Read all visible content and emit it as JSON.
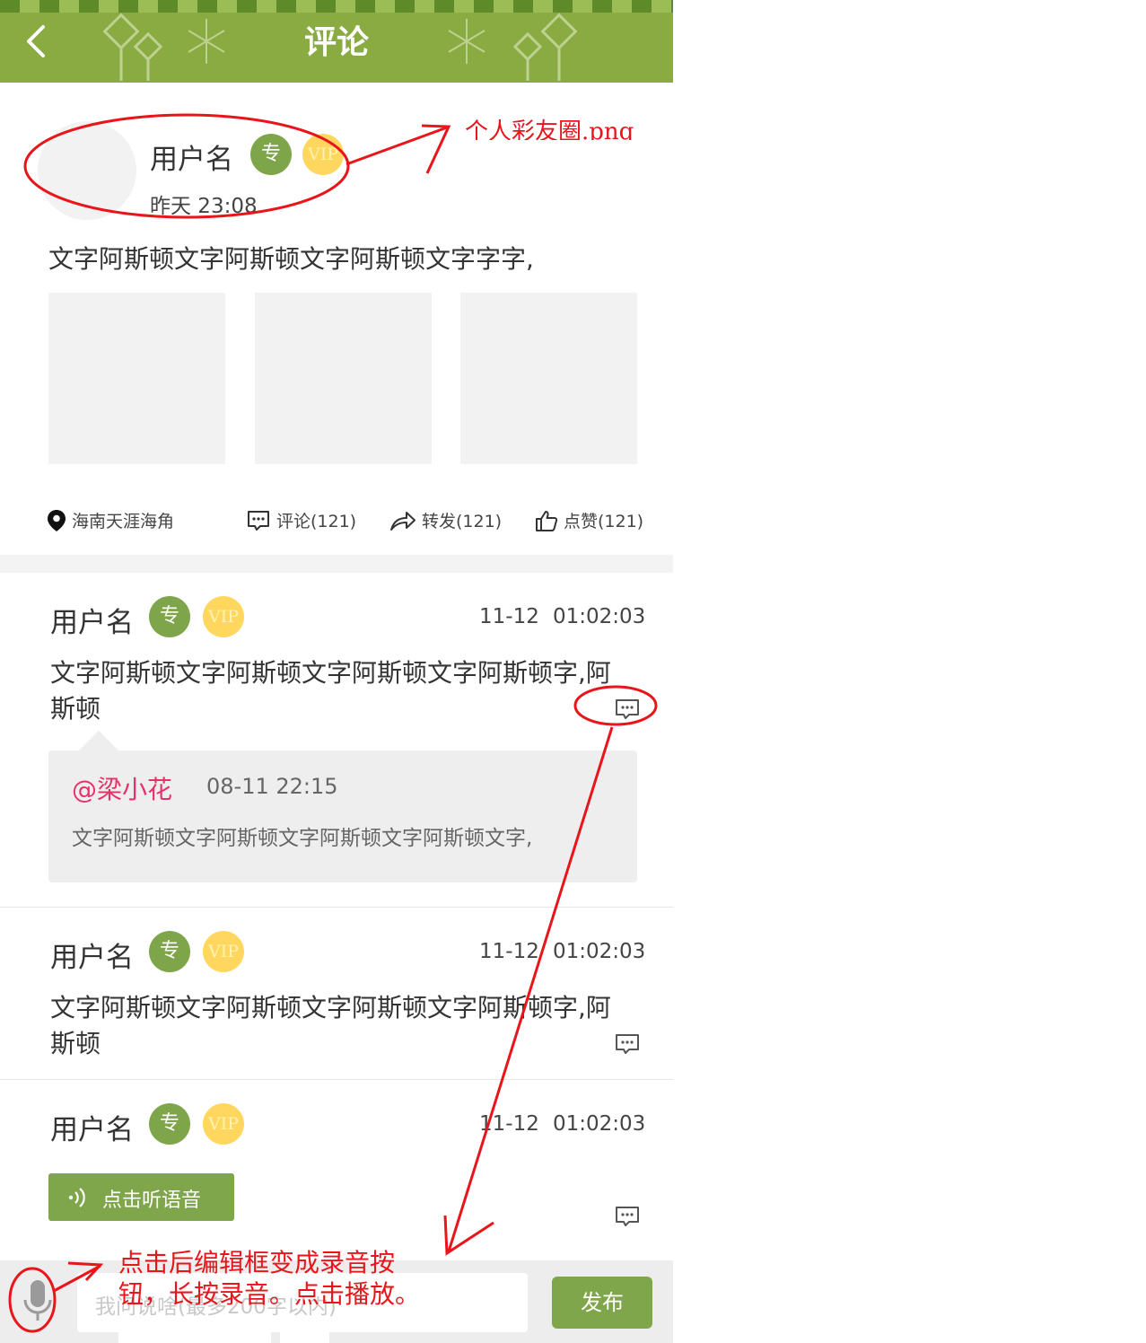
{
  "header": {
    "title": "评论"
  },
  "post": {
    "username": "用户名",
    "badge_zhuan": "专",
    "badge_vip": "VIP",
    "time": "昨天 23:08",
    "text": "文字阿斯顿文字阿斯顿文字阿斯顿文字字字,",
    "location": "海南天涯海角",
    "comment_label": "评论(121)",
    "forward_label": "转发(121)",
    "like_label": "点赞(121)"
  },
  "comments": [
    {
      "username": "用户名",
      "badge_zhuan": "专",
      "badge_vip": "VIP",
      "date": "11-12",
      "time": "01:02:03",
      "text": "文字阿斯顿文字阿斯顿文字阿斯顿文字阿斯顿字,阿斯顿",
      "reply": {
        "at_user": "@梁小花",
        "date": "08-11  22:15",
        "text": "文字阿斯顿文字阿斯顿文字阿斯顿文字阿斯顿文字,"
      }
    },
    {
      "username": "用户名",
      "badge_zhuan": "专",
      "badge_vip": "VIP",
      "date": "11-12",
      "time": "01:02:03",
      "text": "文字阿斯顿文字阿斯顿文字阿斯顿文字阿斯顿字,阿斯顿"
    },
    {
      "username": "用户名",
      "badge_zhuan": "专",
      "badge_vip": "VIP",
      "date": "11-12",
      "time": "01:02:03",
      "voice_label": "点击听语音"
    }
  ],
  "bottom": {
    "input_placeholder": "我问说啥(最多200字以内)",
    "publish_label": "发布"
  },
  "annotations": {
    "top_note": "个人彩友圈.png",
    "bottom_note_line1": "点击后编辑框变成录音按",
    "bottom_note_line2": "钮，长按录音。点击播放。"
  },
  "colors": {
    "brand_green": "#8aab42",
    "button_green": "#80a64c",
    "annotation_red": "#e8151b",
    "mention_pink": "#e8316b",
    "vip_yellow": "#ffd75e"
  },
  "icons": [
    "back-chevron-icon",
    "location-pin-icon",
    "comment-bubble-icon",
    "forward-arrow-icon",
    "thumbs-up-icon",
    "speaker-wave-icon",
    "microphone-icon"
  ]
}
